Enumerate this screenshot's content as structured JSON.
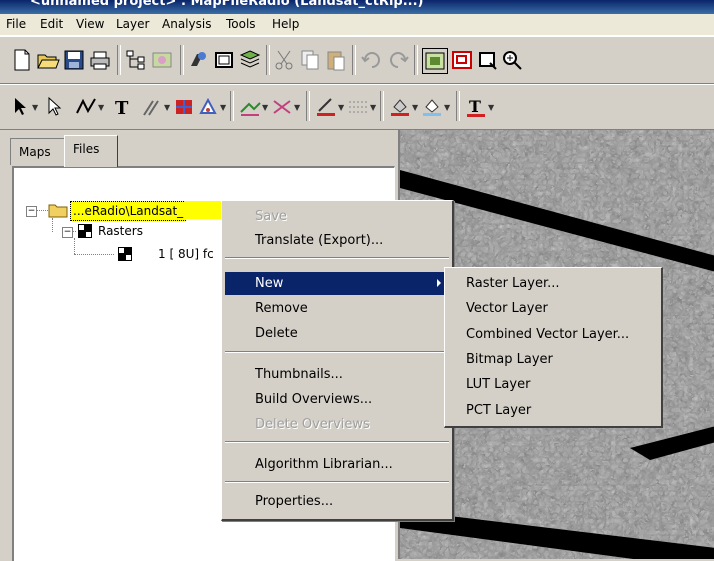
{
  "window": {
    "title": "<unnamed project> : MapFileRadio (Landsat_ctRip...)"
  },
  "menubar": [
    {
      "label": "File"
    },
    {
      "label": "Edit"
    },
    {
      "label": "View"
    },
    {
      "label": "Layer"
    },
    {
      "label": "Analysis"
    },
    {
      "label": "Tools"
    },
    {
      "label": "Help"
    }
  ],
  "left_panel": {
    "tabs": [
      {
        "label": "Maps"
      },
      {
        "label": "Files"
      }
    ],
    "tree": {
      "root_label": "...eRadio\\Landsat_",
      "rasters_label": "Rasters",
      "child_label": "1 [ 8U] fc"
    }
  },
  "context_menu": {
    "items": [
      {
        "label": "Save",
        "disabled": true
      },
      {
        "label": "Translate (Export)..."
      },
      {
        "label": "New",
        "highlighted": true,
        "submenu": true
      },
      {
        "label": "Remove"
      },
      {
        "label": "Delete"
      },
      {
        "label": "Thumbnails..."
      },
      {
        "label": "Build Overviews..."
      },
      {
        "label": "Delete Overviews",
        "disabled": true
      },
      {
        "label": "Algorithm Librarian..."
      },
      {
        "label": "Properties..."
      }
    ]
  },
  "submenu_new": {
    "items": [
      {
        "label": "Raster Layer..."
      },
      {
        "label": "Vector Layer"
      },
      {
        "label": "Combined Vector Layer..."
      },
      {
        "label": "Bitmap Layer"
      },
      {
        "label": "LUT Layer"
      },
      {
        "label": "PCT Layer"
      }
    ]
  },
  "colors": {
    "highlight": "#0a246a",
    "selection_bg": "#ffff00",
    "chrome": "#d4d0c8"
  }
}
